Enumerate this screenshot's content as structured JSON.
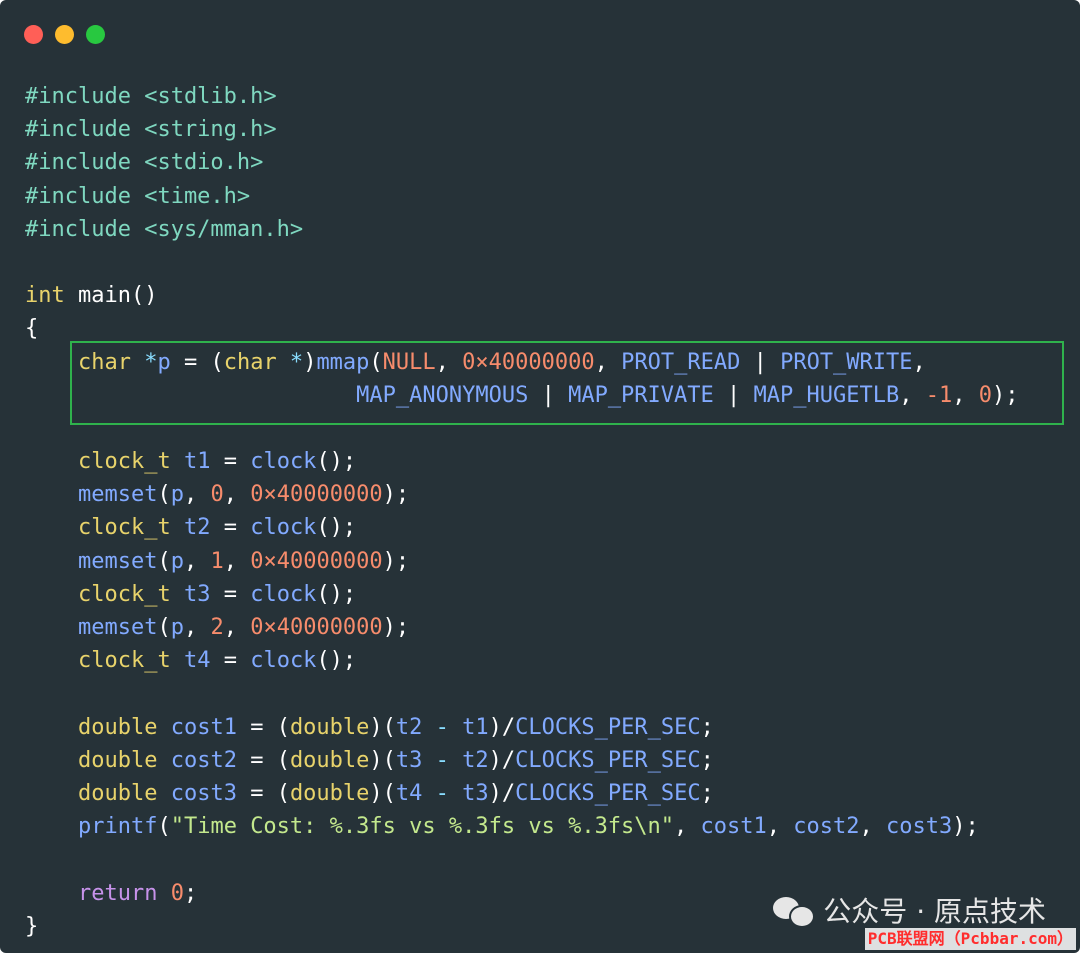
{
  "window": {
    "controls": [
      {
        "name": "close",
        "color": "#ff5f57"
      },
      {
        "name": "minimize",
        "color": "#febc2e"
      },
      {
        "name": "maximize",
        "color": "#28c840"
      }
    ]
  },
  "code_lines": [
    [
      {
        "t": "#include <stdlib.h>",
        "c": "pre"
      }
    ],
    [
      {
        "t": "#include <string.h>",
        "c": "pre"
      }
    ],
    [
      {
        "t": "#include <stdio.h>",
        "c": "pre"
      }
    ],
    [
      {
        "t": "#include <time.h>",
        "c": "pre"
      }
    ],
    [
      {
        "t": "#include <sys/mman.h>",
        "c": "pre"
      }
    ],
    [],
    [
      {
        "t": "int",
        "c": "type"
      },
      {
        "t": " main()",
        "c": "plain"
      }
    ],
    [
      {
        "t": "{",
        "c": "plain"
      }
    ],
    [
      {
        "t": "    ",
        "c": "plain"
      },
      {
        "t": "char",
        "c": "type"
      },
      {
        "t": " *",
        "c": "op"
      },
      {
        "t": "p",
        "c": "var"
      },
      {
        "t": " = (",
        "c": "plain"
      },
      {
        "t": "char",
        "c": "type"
      },
      {
        "t": " *",
        "c": "op"
      },
      {
        "t": ")",
        "c": "plain"
      },
      {
        "t": "mmap",
        "c": "func"
      },
      {
        "t": "(",
        "c": "plain"
      },
      {
        "t": "NULL",
        "c": "num"
      },
      {
        "t": ", ",
        "c": "plain"
      },
      {
        "t": "0×40000000",
        "c": "num"
      },
      {
        "t": ", ",
        "c": "plain"
      },
      {
        "t": "PROT_READ",
        "c": "const"
      },
      {
        "t": " | ",
        "c": "plain"
      },
      {
        "t": "PROT_WRITE",
        "c": "const"
      },
      {
        "t": ",",
        "c": "plain"
      }
    ],
    [
      {
        "t": "                         ",
        "c": "plain"
      },
      {
        "t": "MAP_ANONYMOUS",
        "c": "const"
      },
      {
        "t": " | ",
        "c": "plain"
      },
      {
        "t": "MAP_PRIVATE",
        "c": "const"
      },
      {
        "t": " | ",
        "c": "plain"
      },
      {
        "t": "MAP_HUGETLB",
        "c": "const"
      },
      {
        "t": ", ",
        "c": "plain"
      },
      {
        "t": "-1",
        "c": "num"
      },
      {
        "t": ", ",
        "c": "plain"
      },
      {
        "t": "0",
        "c": "num"
      },
      {
        "t": ");",
        "c": "plain"
      }
    ],
    [],
    [
      {
        "t": "    ",
        "c": "plain"
      },
      {
        "t": "clock_t",
        "c": "type"
      },
      {
        "t": " t1",
        "c": "var"
      },
      {
        "t": " = ",
        "c": "plain"
      },
      {
        "t": "clock",
        "c": "func"
      },
      {
        "t": "();",
        "c": "plain"
      }
    ],
    [
      {
        "t": "    ",
        "c": "plain"
      },
      {
        "t": "memset",
        "c": "func"
      },
      {
        "t": "(",
        "c": "plain"
      },
      {
        "t": "p",
        "c": "var"
      },
      {
        "t": ", ",
        "c": "plain"
      },
      {
        "t": "0",
        "c": "num"
      },
      {
        "t": ", ",
        "c": "plain"
      },
      {
        "t": "0×40000000",
        "c": "num"
      },
      {
        "t": ");",
        "c": "plain"
      }
    ],
    [
      {
        "t": "    ",
        "c": "plain"
      },
      {
        "t": "clock_t",
        "c": "type"
      },
      {
        "t": " t2",
        "c": "var"
      },
      {
        "t": " = ",
        "c": "plain"
      },
      {
        "t": "clock",
        "c": "func"
      },
      {
        "t": "();",
        "c": "plain"
      }
    ],
    [
      {
        "t": "    ",
        "c": "plain"
      },
      {
        "t": "memset",
        "c": "func"
      },
      {
        "t": "(",
        "c": "plain"
      },
      {
        "t": "p",
        "c": "var"
      },
      {
        "t": ", ",
        "c": "plain"
      },
      {
        "t": "1",
        "c": "num"
      },
      {
        "t": ", ",
        "c": "plain"
      },
      {
        "t": "0×40000000",
        "c": "num"
      },
      {
        "t": ");",
        "c": "plain"
      }
    ],
    [
      {
        "t": "    ",
        "c": "plain"
      },
      {
        "t": "clock_t",
        "c": "type"
      },
      {
        "t": " t3",
        "c": "var"
      },
      {
        "t": " = ",
        "c": "plain"
      },
      {
        "t": "clock",
        "c": "func"
      },
      {
        "t": "();",
        "c": "plain"
      }
    ],
    [
      {
        "t": "    ",
        "c": "plain"
      },
      {
        "t": "memset",
        "c": "func"
      },
      {
        "t": "(",
        "c": "plain"
      },
      {
        "t": "p",
        "c": "var"
      },
      {
        "t": ", ",
        "c": "plain"
      },
      {
        "t": "2",
        "c": "num"
      },
      {
        "t": ", ",
        "c": "plain"
      },
      {
        "t": "0×40000000",
        "c": "num"
      },
      {
        "t": ");",
        "c": "plain"
      }
    ],
    [
      {
        "t": "    ",
        "c": "plain"
      },
      {
        "t": "clock_t",
        "c": "type"
      },
      {
        "t": " t4",
        "c": "var"
      },
      {
        "t": " = ",
        "c": "plain"
      },
      {
        "t": "clock",
        "c": "func"
      },
      {
        "t": "();",
        "c": "plain"
      }
    ],
    [],
    [
      {
        "t": "    ",
        "c": "plain"
      },
      {
        "t": "double",
        "c": "type"
      },
      {
        "t": " cost1",
        "c": "var"
      },
      {
        "t": " = (",
        "c": "plain"
      },
      {
        "t": "double",
        "c": "type"
      },
      {
        "t": ")(",
        "c": "plain"
      },
      {
        "t": "t2",
        "c": "var"
      },
      {
        "t": " - ",
        "c": "op"
      },
      {
        "t": "t1",
        "c": "var"
      },
      {
        "t": ")/",
        "c": "plain"
      },
      {
        "t": "CLOCKS_PER_SEC",
        "c": "const"
      },
      {
        "t": ";",
        "c": "plain"
      }
    ],
    [
      {
        "t": "    ",
        "c": "plain"
      },
      {
        "t": "double",
        "c": "type"
      },
      {
        "t": " cost2",
        "c": "var"
      },
      {
        "t": " = (",
        "c": "plain"
      },
      {
        "t": "double",
        "c": "type"
      },
      {
        "t": ")(",
        "c": "plain"
      },
      {
        "t": "t3",
        "c": "var"
      },
      {
        "t": " - ",
        "c": "op"
      },
      {
        "t": "t2",
        "c": "var"
      },
      {
        "t": ")/",
        "c": "plain"
      },
      {
        "t": "CLOCKS_PER_SEC",
        "c": "const"
      },
      {
        "t": ";",
        "c": "plain"
      }
    ],
    [
      {
        "t": "    ",
        "c": "plain"
      },
      {
        "t": "double",
        "c": "type"
      },
      {
        "t": " cost3",
        "c": "var"
      },
      {
        "t": " = (",
        "c": "plain"
      },
      {
        "t": "double",
        "c": "type"
      },
      {
        "t": ")(",
        "c": "plain"
      },
      {
        "t": "t4",
        "c": "var"
      },
      {
        "t": " - ",
        "c": "op"
      },
      {
        "t": "t3",
        "c": "var"
      },
      {
        "t": ")/",
        "c": "plain"
      },
      {
        "t": "CLOCKS_PER_SEC",
        "c": "const"
      },
      {
        "t": ";",
        "c": "plain"
      }
    ],
    [
      {
        "t": "    ",
        "c": "plain"
      },
      {
        "t": "printf",
        "c": "func"
      },
      {
        "t": "(",
        "c": "plain"
      },
      {
        "t": "\"Time Cost: %.3fs vs %.3fs vs %.3fs\\n\"",
        "c": "str"
      },
      {
        "t": ", ",
        "c": "plain"
      },
      {
        "t": "cost1",
        "c": "var"
      },
      {
        "t": ", ",
        "c": "plain"
      },
      {
        "t": "cost2",
        "c": "var"
      },
      {
        "t": ", ",
        "c": "plain"
      },
      {
        "t": "cost3",
        "c": "var"
      },
      {
        "t": ");",
        "c": "plain"
      }
    ],
    [],
    [
      {
        "t": "    ",
        "c": "plain"
      },
      {
        "t": "return",
        "c": "kw"
      },
      {
        "t": " ",
        "c": "plain"
      },
      {
        "t": "0",
        "c": "num"
      },
      {
        "t": ";",
        "c": "plain"
      }
    ],
    [
      {
        "t": "}",
        "c": "plain"
      }
    ]
  ],
  "highlight": {
    "color": "#2fb24c",
    "covers_lines": [
      9,
      10
    ]
  },
  "watermark": {
    "icon": "wechat-icon",
    "text": "公众号 · 原点技术",
    "site_text": "PCB联盟网（Pcbbar.com）"
  }
}
